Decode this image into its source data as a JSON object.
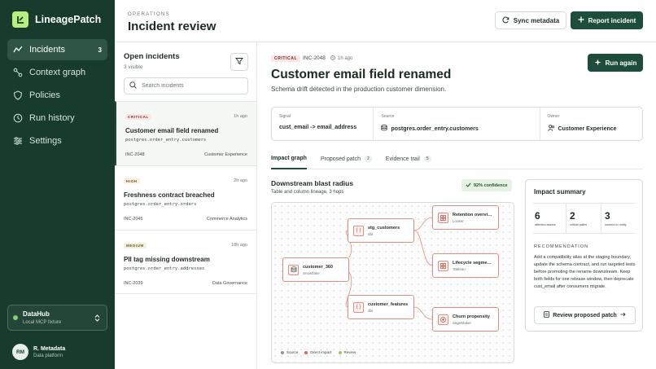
{
  "app": {
    "name": "LineagePatch"
  },
  "sidebar": {
    "items": [
      {
        "label": "Incidents",
        "count": "3",
        "icon": "alert-icon",
        "active": true
      },
      {
        "label": "Context graph",
        "icon": "graph-icon"
      },
      {
        "label": "Policies",
        "icon": "shield-icon"
      },
      {
        "label": "Run history",
        "icon": "clock-icon"
      },
      {
        "label": "Settings",
        "icon": "sliders-icon"
      }
    ],
    "workspace": {
      "title": "DataHub",
      "subtitle": "Local MCP fixture"
    },
    "user": {
      "initials": "RM",
      "name": "R. Metadata",
      "role": "Data platform"
    }
  },
  "header": {
    "eyebrow": "OPERATIONS",
    "title": "Incident review",
    "sync_label": "Sync metadata",
    "report_label": "Report incident"
  },
  "incidents_panel": {
    "title": "Open incidents",
    "subtitle": "3 visible",
    "search_placeholder": "Search incidents",
    "items": [
      {
        "severity": "CRITICAL",
        "time": "1h ago",
        "title": "Customer email field renamed",
        "path": "postgres.order_entry.customers",
        "id": "INC-2048",
        "owner": "Customer Experience"
      },
      {
        "severity": "HIGH",
        "time": "2h ago",
        "title": "Freshness contract breached",
        "path": "postgres.order_entry.orders",
        "id": "INC-2045",
        "owner": "Commerce Analytics"
      },
      {
        "severity": "MEDIUM",
        "time": "18h ago",
        "title": "PII tag missing downstream",
        "path": "postgres.order_entry.addresses",
        "id": "INC-2039",
        "owner": "Data Governance"
      }
    ]
  },
  "detail": {
    "severity": "CRITICAL",
    "id": "INC-2048",
    "time": "1h ago",
    "title": "Customer email field renamed",
    "subtitle": "Schema drift detected in the production customer dimension.",
    "run_again_label": "Run again",
    "signal": {
      "label": "Signal",
      "value": "cust_email -> email_address"
    },
    "source": {
      "label": "Source",
      "value": "postgres.order_entry.customers"
    },
    "owner": {
      "label": "Owner",
      "value": "Customer Experience"
    },
    "tabs": [
      {
        "label": "Impact graph",
        "count": ""
      },
      {
        "label": "Proposed patch",
        "count": "2"
      },
      {
        "label": "Evidence trail",
        "count": "5"
      }
    ]
  },
  "graph": {
    "title": "Downstream blast radius",
    "subtitle": "Table and column lineage, 3 hops",
    "confidence": "92% confidence",
    "nodes": [
      {
        "name": "customer_360",
        "kind": "Snowflake",
        "type": "source"
      },
      {
        "name": "stg_customers",
        "kind": "dbt",
        "type": "impact"
      },
      {
        "name": "customer_features",
        "kind": "dbt",
        "type": "impact"
      },
      {
        "name": "Retention overview",
        "kind": "Looker",
        "type": "impact"
      },
      {
        "name": "Lifecycle segments",
        "kind": "Tableau",
        "type": "impact"
      },
      {
        "name": "Churn propensity",
        "kind": "SageMaker",
        "type": "impact"
      }
    ],
    "legend": [
      {
        "label": "Source",
        "color": "#8a968e"
      },
      {
        "label": "Direct impact",
        "color": "#d9685b"
      },
      {
        "label": "Review",
        "color": "#a9c25a"
      }
    ]
  },
  "summary": {
    "title": "Impact summary",
    "stats": [
      {
        "value": "6",
        "label": "affected assets"
      },
      {
        "value": "2",
        "label": "critical paths"
      },
      {
        "value": "3",
        "label": "owners to notify"
      }
    ],
    "rec_label": "RECOMMENDATION",
    "rec_text": "Add a compatibility alias at the staging boundary, update the schema contract, and run targeted tests before promoting the rename downstream. Keep both fields for one release window, then deprecate cust_email after consumers migrate.",
    "review_label": "Review proposed patch"
  },
  "colors": {
    "sidebar": "#173b2d",
    "primary": "#1d4d3b",
    "accent": "#b8ef7c",
    "critical": "#e58c82"
  }
}
